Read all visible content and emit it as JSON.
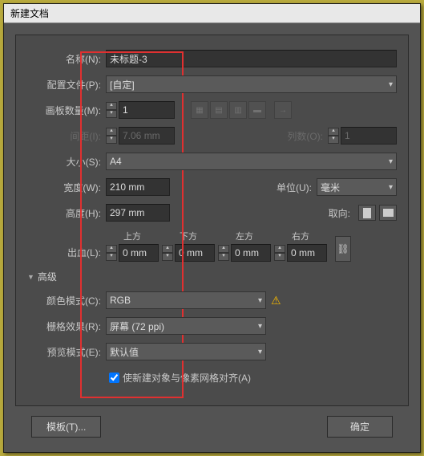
{
  "title": "新建文档",
  "name": {
    "label": "名称(N):",
    "value": "未标题-3"
  },
  "profile": {
    "label": "配置文件(P):",
    "value": "[自定]"
  },
  "artboards": {
    "label": "画板数量(M):",
    "value": "1"
  },
  "spacing": {
    "label": "间距(I):",
    "value": "7.06 mm"
  },
  "columns": {
    "label": "列数(O):",
    "value": "1"
  },
  "size": {
    "label": "大小(S):",
    "value": "A4"
  },
  "width": {
    "label": "宽度(W):",
    "value": "210 mm"
  },
  "units": {
    "label": "单位(U):",
    "value": "毫米"
  },
  "height": {
    "label": "高度(H):",
    "value": "297 mm"
  },
  "orient": {
    "label": "取向:"
  },
  "bleed": {
    "label": "出血(L):",
    "top": {
      "h": "上方",
      "v": "0 mm"
    },
    "bottom": {
      "h": "下方",
      "v": "0 mm"
    },
    "left": {
      "h": "左方",
      "v": "0 mm"
    },
    "right": {
      "h": "右方",
      "v": "0 mm"
    }
  },
  "advanced": "高级",
  "colorMode": {
    "label": "颜色模式(C):",
    "value": "RGB"
  },
  "raster": {
    "label": "栅格效果(R):",
    "value": "屏幕 (72 ppi)"
  },
  "preview": {
    "label": "预览模式(E):",
    "value": "默认值"
  },
  "alignGrid": "使新建对象与像素网格对齐(A)",
  "templateBtn": "模板(T)...",
  "okBtn": "确定"
}
